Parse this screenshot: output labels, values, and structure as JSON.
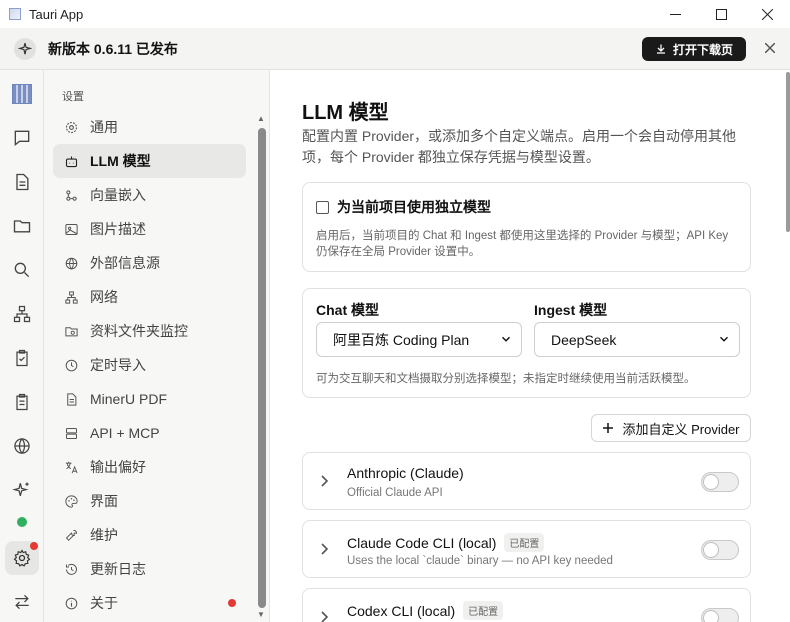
{
  "window": {
    "title": "Tauri App"
  },
  "banner": {
    "text": "新版本 0.6.11 已发布",
    "button": "打开下载页"
  },
  "nav": {
    "header": "设置",
    "items": [
      {
        "label": "通用",
        "icon": "gear-icon"
      },
      {
        "label": "LLM 模型",
        "icon": "bot-icon",
        "active": true
      },
      {
        "label": "向量嵌入",
        "icon": "nodes-icon"
      },
      {
        "label": "图片描述",
        "icon": "image-icon"
      },
      {
        "label": "外部信息源",
        "icon": "globe-icon"
      },
      {
        "label": "网络",
        "icon": "network-icon"
      },
      {
        "label": "资料文件夹监控",
        "icon": "folder-watch-icon"
      },
      {
        "label": "定时导入",
        "icon": "clock-icon"
      },
      {
        "label": "MinerU PDF",
        "icon": "document-icon"
      },
      {
        "label": "API + MCP",
        "icon": "server-icon"
      },
      {
        "label": "输出偏好",
        "icon": "translate-icon"
      },
      {
        "label": "界面",
        "icon": "palette-icon"
      },
      {
        "label": "维护",
        "icon": "wrench-icon"
      },
      {
        "label": "更新日志",
        "icon": "history-icon"
      },
      {
        "label": "关于",
        "icon": "info-icon"
      }
    ]
  },
  "content": {
    "title": "LLM 模型",
    "description": "配置内置 Provider，或添加多个自定义端点。启用一个会自动停用其他项，每个 Provider 都独立保存凭据与模型设置。",
    "independent": {
      "label": "为当前项目使用独立模型",
      "hint": "启用后，当前项目的 Chat 和 Ingest 都使用这里选择的 Provider 与模型；API Key 仍保存在全局 Provider 设置中。"
    },
    "models": {
      "chat_label": "Chat 模型",
      "chat_value": "阿里百炼 Coding Plan",
      "ingest_label": "Ingest 模型",
      "ingest_value": "DeepSeek",
      "hint": "可为交互聊天和文档摄取分别选择模型；未指定时继续使用当前活跃模型。"
    },
    "add_button": "添加自定义 Provider",
    "providers": [
      {
        "name": "Anthropic (Claude)",
        "tag": "",
        "subtitle": "Official Claude API",
        "enabled": false
      },
      {
        "name": "Claude Code CLI (local)",
        "tag": "已配置",
        "subtitle": "Uses the local `claude` binary — no API key needed",
        "enabled": false
      },
      {
        "name": "Codex CLI (local)",
        "tag": "已配置",
        "subtitle": "",
        "enabled": false
      }
    ]
  }
}
